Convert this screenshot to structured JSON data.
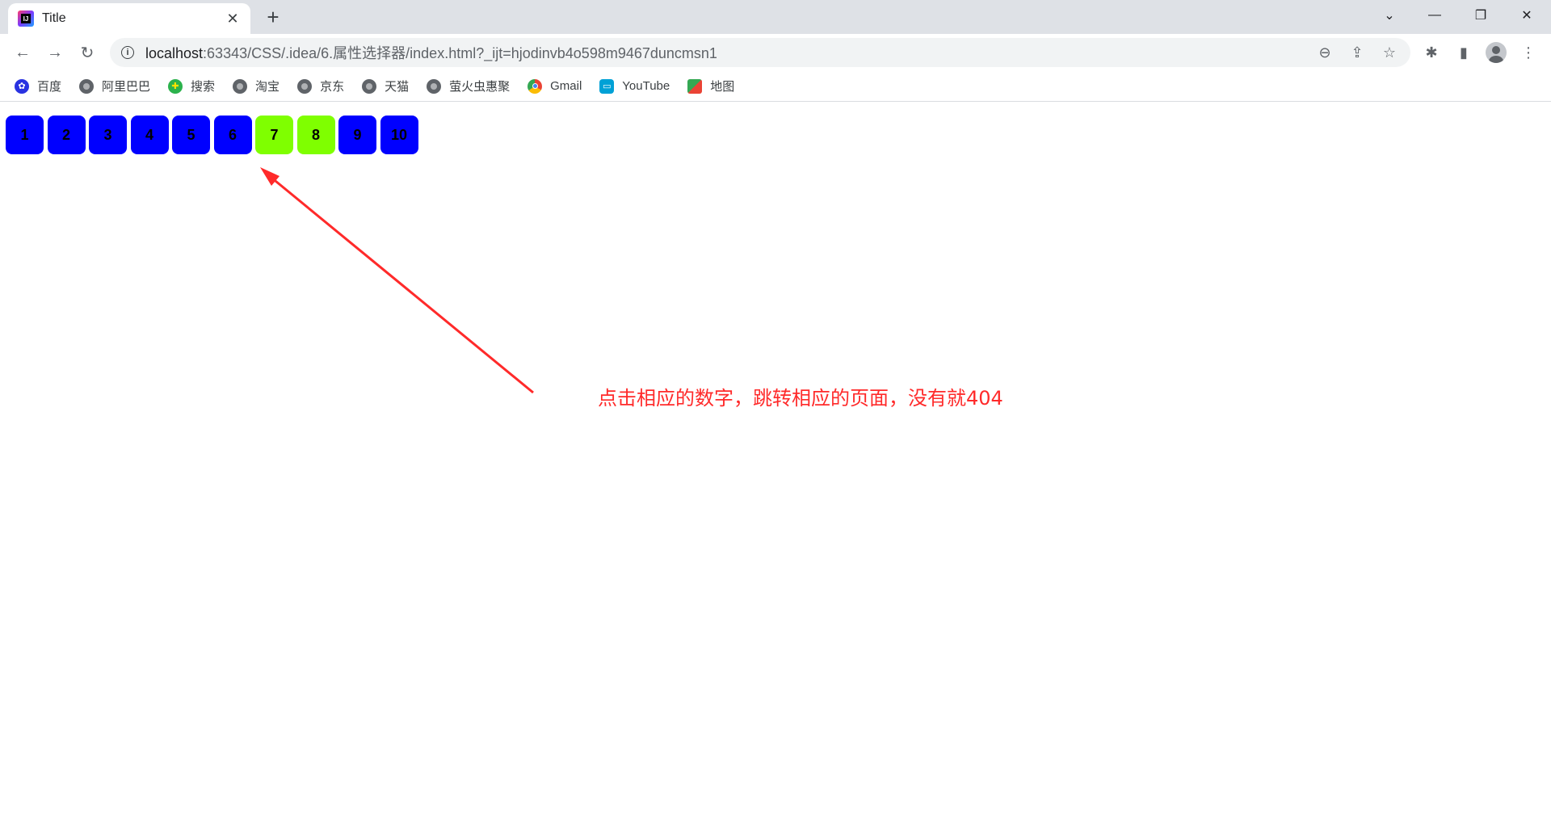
{
  "browser": {
    "tab": {
      "title": "Title"
    },
    "new_tab_symbol": "+",
    "window_controls": {
      "dropdown": "⌄",
      "minimize": "—",
      "restore": "❐",
      "close": "✕"
    },
    "url": {
      "host": "localhost",
      "rest": ":63343/CSS/.idea/6.属性选择器/index.html?_ijt=hjodinvb4o598m9467duncmsn1"
    }
  },
  "bookmarks": [
    {
      "label": "百度",
      "icon": "baidu-paw-icon",
      "color": "#2932e1"
    },
    {
      "label": "阿里巴巴",
      "icon": "globe-icon"
    },
    {
      "label": "搜索",
      "icon": "search-plus-icon",
      "color": "#2bb24c"
    },
    {
      "label": "淘宝",
      "icon": "globe-icon"
    },
    {
      "label": "京东",
      "icon": "globe-icon"
    },
    {
      "label": "天猫",
      "icon": "globe-icon"
    },
    {
      "label": "萤火虫惠聚",
      "icon": "globe-icon"
    },
    {
      "label": "Gmail",
      "icon": "chrome-icon"
    },
    {
      "label": "YouTube",
      "icon": "tv-icon",
      "color": "#00a1d6"
    },
    {
      "label": "地图",
      "icon": "maps-icon"
    }
  ],
  "pagination": {
    "pages": [
      "1",
      "2",
      "3",
      "4",
      "5",
      "6",
      "7",
      "8",
      "9",
      "10"
    ],
    "active_pages": [
      "7",
      "8"
    ],
    "colors": {
      "default": "#0000ff",
      "active": "#7fff00"
    }
  },
  "annotation": {
    "text": "点击相应的数字，跳转相应的页面，没有就404",
    "color": "#ff2a2a"
  }
}
